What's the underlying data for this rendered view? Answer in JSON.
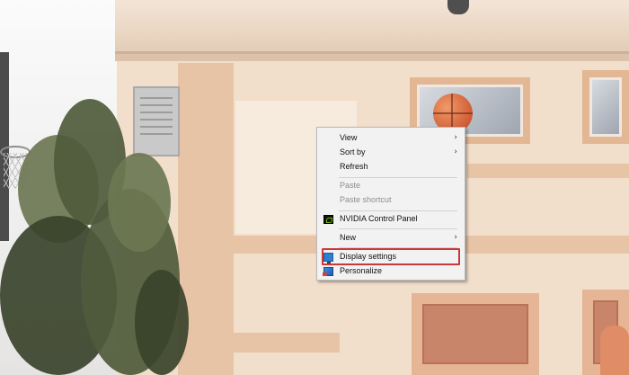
{
  "context_menu": {
    "items": [
      {
        "label": "View",
        "has_submenu": true,
        "enabled": true
      },
      {
        "label": "Sort by",
        "has_submenu": true,
        "enabled": true
      },
      {
        "label": "Refresh",
        "has_submenu": false,
        "enabled": true
      },
      {
        "label": "Paste",
        "has_submenu": false,
        "enabled": false
      },
      {
        "label": "Paste shortcut",
        "has_submenu": false,
        "enabled": false
      },
      {
        "label": "NVIDIA Control Panel",
        "has_submenu": false,
        "enabled": true,
        "icon": "nvidia-icon"
      },
      {
        "label": "New",
        "has_submenu": true,
        "enabled": true
      },
      {
        "label": "Display settings",
        "has_submenu": false,
        "enabled": true,
        "icon": "display-settings-icon",
        "highlighted": true
      },
      {
        "label": "Personalize",
        "has_submenu": false,
        "enabled": true,
        "icon": "personalize-icon"
      }
    ],
    "submenu_glyph": "›",
    "highlight_color": "#c8383c"
  },
  "wallpaper": {
    "description_icon": "photo-wallpaper"
  }
}
